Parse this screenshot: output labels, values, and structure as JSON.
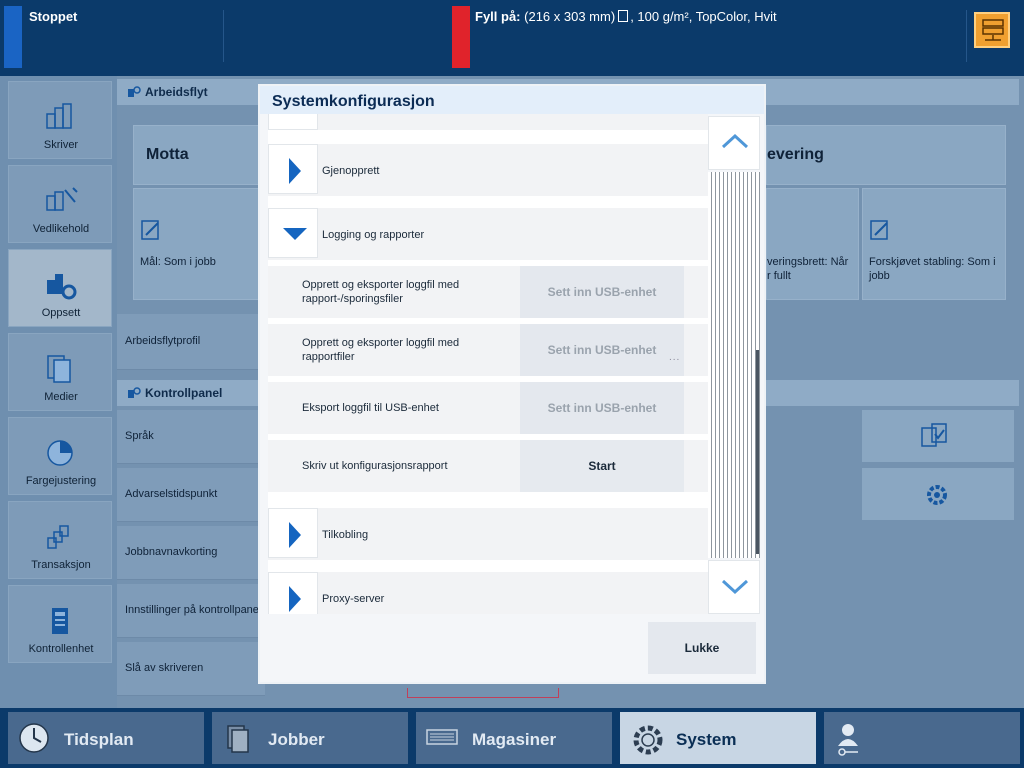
{
  "status": {
    "state": "Stoppet",
    "fill_label": "Fyll på:",
    "fill_size": "(216 x 303 mm)",
    "fill_details": ", 100 g/m², TopColor, Hvit",
    "server_icon": "server-icon"
  },
  "nav": {
    "items": [
      {
        "label": "Skriver",
        "icon": "printer-icon"
      },
      {
        "label": "Vedlikehold",
        "icon": "maintenance-icon"
      },
      {
        "label": "Oppsett",
        "icon": "setup-icon"
      },
      {
        "label": "Medier",
        "icon": "media-icon"
      },
      {
        "label": "Fargejustering",
        "icon": "color-adjust-icon"
      },
      {
        "label": "Transaksjon",
        "icon": "transaction-icon"
      },
      {
        "label": "Kontrollenhet",
        "icon": "controller-icon"
      }
    ],
    "active": "Oppsett"
  },
  "background": {
    "workflow_heading": "Arbeidsflyt",
    "receive": "Motta",
    "target": "Mål: Som i jobb",
    "delivery_partial": "evering",
    "delivery_tray_partial": "veringsbrett: Når\nr fullt",
    "offset_stacking": "Forskjøvet stabling: Som i jobb",
    "workflow_profile": "Arbeidsflytprofil",
    "control_panel_heading": "Kontrollpanel",
    "rows": [
      "Språk",
      "Advarselstidspunkt",
      "Jobbnavnavkorting",
      "Innstillinger på kontrollpanel",
      "Slå av skriveren"
    ]
  },
  "modal": {
    "title": "Systemkonfigurasjon",
    "sections": [
      {
        "label": "Gjenopprett",
        "expanded": false
      },
      {
        "label": "Logging og rapporter",
        "expanded": true
      },
      {
        "label": "Tilkobling",
        "expanded": false
      },
      {
        "label": "Proxy-server",
        "expanded": false
      }
    ],
    "logging_items": [
      {
        "label": "Opprett og eksporter loggfil med\nrapport-/sporingsfiler",
        "action": "Sett inn USB-enhet",
        "enabled": false
      },
      {
        "label": "Opprett og eksporter loggfil med\nrapportfiler",
        "action": "Sett inn USB-enhet",
        "enabled": false
      },
      {
        "label": "Eksport loggfil til USB-enhet",
        "action": "Sett inn USB-enhet",
        "enabled": false
      },
      {
        "label": "Skriv ut konfigurasjonsrapport",
        "action": "Start",
        "enabled": true
      }
    ],
    "more": "...",
    "close": "Lukke"
  },
  "bottom_tabs": [
    {
      "label": "Tidsplan",
      "icon": "clock-icon"
    },
    {
      "label": "Jobber",
      "icon": "jobs-icon"
    },
    {
      "label": "Magasiner",
      "icon": "trays-icon"
    },
    {
      "label": "System",
      "icon": "gear-icon",
      "active": true
    },
    {
      "label": "",
      "icon": "user-key-icon"
    }
  ],
  "colors": {
    "top_bar": "#0b3a6a",
    "status_stopped": "#1a64c4",
    "status_alert": "#e0232b",
    "accent_blue": "#1565c0",
    "server_button": "#f0a030"
  }
}
